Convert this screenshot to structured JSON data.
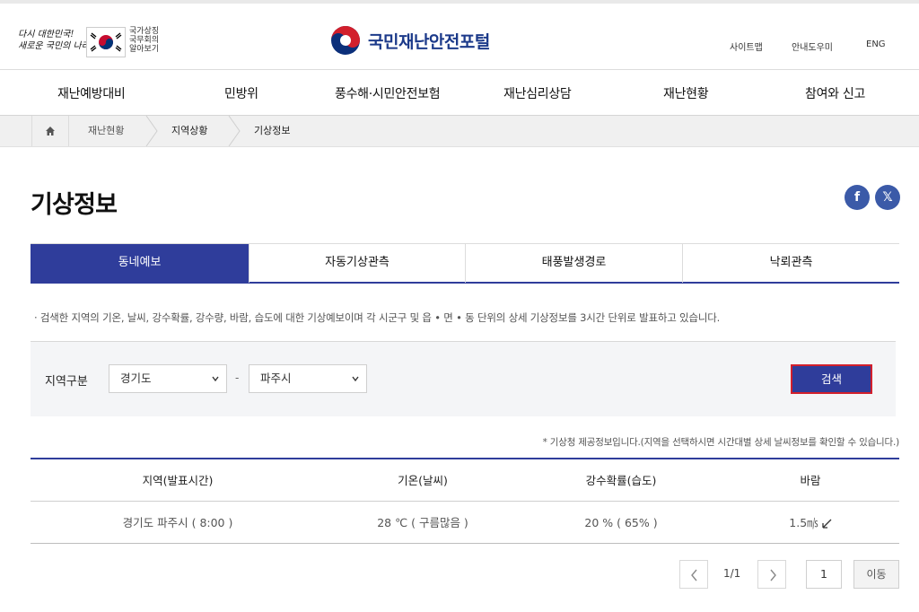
{
  "header": {
    "slogan": [
      "다시 대한민국!",
      "새로운 국민의 나라"
    ],
    "sub_emblem": [
      "국가상징",
      "국무회의",
      "알아보기"
    ],
    "portal_title": "국민재난안전포털",
    "util_links": [
      "사이트맵",
      "안내도우미",
      "ENG"
    ],
    "colors": {
      "brand": "#1c3a8a",
      "accent": "#2f3d9b",
      "highlight": "#d21f2c"
    }
  },
  "gnb": [
    "재난예방대비",
    "민방위",
    "풍수해·시민안전보험",
    "재난심리상담",
    "재난현황",
    "참여와 신고"
  ],
  "breadcrumb": [
    "재난현황",
    "지역상황",
    "기상정보"
  ],
  "page": {
    "title": "기상정보",
    "share": {
      "facebook": "f",
      "x": "𝕏"
    }
  },
  "tabs": [
    "동네예보",
    "자동기상관측",
    "태풍발생경로",
    "낙뢰관측"
  ],
  "description": "· 검색한 지역의 기온, 날씨, 강수확률, 강수량, 바람, 습도에 대한 기상예보이며 각 시군구 및 읍 • 면 • 동 단위의 상세 기상정보를 3시간 단위로 발표하고 있습니다.",
  "search": {
    "label": "지역구분",
    "province": "경기도",
    "separator": "-",
    "city": "파주시",
    "button": "검색"
  },
  "note": "* 기상청 제공정보입니다.(지역을 선택하시면 시간대별 상세 날씨정보를 확인할 수 있습니다.)",
  "table": {
    "headers": [
      "지역(발표시간)",
      "기온(날씨)",
      "강수확률(습도)",
      "바람"
    ],
    "rows": [
      {
        "region": "경기도 파주시 ( 8:00 )",
        "temp": "28 ℃ ( 구름많음 )",
        "rain": "20 % ( 65% )",
        "wind": "1.5㎧"
      }
    ]
  },
  "pagination": {
    "info": "1/1",
    "page_input": "1",
    "go_label": "이동"
  }
}
